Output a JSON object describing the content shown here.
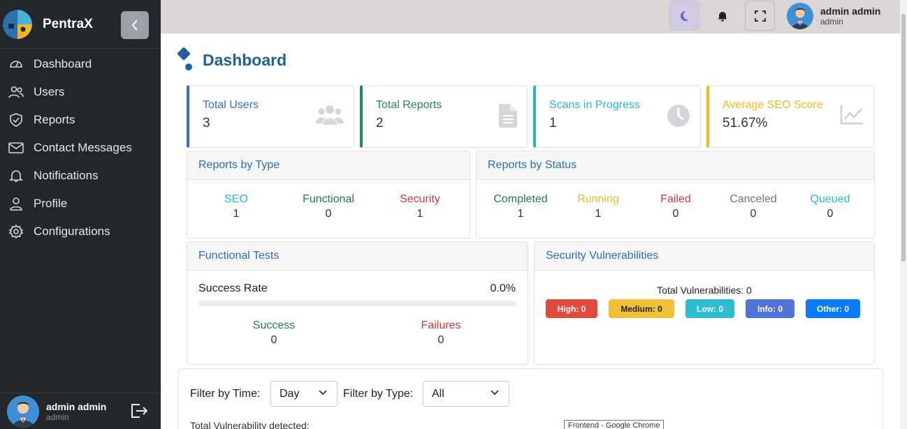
{
  "brand": {
    "name": "PentraX"
  },
  "sidebar": {
    "items": [
      {
        "label": "Dashboard",
        "icon": "dashboard-icon"
      },
      {
        "label": "Users",
        "icon": "users-icon"
      },
      {
        "label": "Reports",
        "icon": "shield-icon"
      },
      {
        "label": "Contact Messages",
        "icon": "envelope-icon"
      },
      {
        "label": "Notifications",
        "icon": "bell-icon"
      },
      {
        "label": "Profile",
        "icon": "user-icon"
      },
      {
        "label": "Configurations",
        "icon": "gear-icon"
      }
    ],
    "user": {
      "name": "admin admin",
      "role": "admin"
    }
  },
  "topbar": {
    "user": {
      "name": "admin admin",
      "role": "admin"
    }
  },
  "page": {
    "title": "Dashboard"
  },
  "stats": [
    {
      "label": "Total Users",
      "value": "3",
      "color": "#2f6fd6"
    },
    {
      "label": "Total Reports",
      "value": "2",
      "color": "#1e8a5a"
    },
    {
      "label": "Scans in Progress",
      "value": "1",
      "color": "#27b5d0"
    },
    {
      "label": "Average SEO Score",
      "value": "51.67%",
      "color": "#f2b81f"
    }
  ],
  "reports_by_type": {
    "title": "Reports by Type",
    "items": [
      {
        "label": "SEO",
        "value": "1",
        "color": "#27b5d0"
      },
      {
        "label": "Functional",
        "value": "0",
        "color": "#1e7e46"
      },
      {
        "label": "Security",
        "value": "1",
        "color": "#d9343b"
      }
    ]
  },
  "reports_by_status": {
    "title": "Reports by Status",
    "items": [
      {
        "label": "Completed",
        "value": "1",
        "color": "#1e7e46"
      },
      {
        "label": "Running",
        "value": "1",
        "color": "#f2b81f"
      },
      {
        "label": "Failed",
        "value": "0",
        "color": "#d9343b"
      },
      {
        "label": "Canceled",
        "value": "0",
        "color": "#6c757d"
      },
      {
        "label": "Queued",
        "value": "0",
        "color": "#27b5d0"
      }
    ]
  },
  "functional_tests": {
    "title": "Functional Tests",
    "success_rate_label": "Success Rate",
    "success_rate": "0.0%",
    "success_rate_fraction": 0.0,
    "success_label": "Success",
    "success_value": "0",
    "failures_label": "Failures",
    "failures_value": "0"
  },
  "security": {
    "title": "Security Vulnerabilities",
    "total_text": "Total Vulnerabilities: 0",
    "badges": [
      {
        "label": "High: 0",
        "color": "#e04a3c",
        "text_color": "#ffffff"
      },
      {
        "label": "Medium: 0",
        "color": "#f2c037",
        "text_color": "#222222"
      },
      {
        "label": "Low: 0",
        "color": "#2fbcd0",
        "text_color": "#ffffff"
      },
      {
        "label": "Info: 0",
        "color": "#4f73d9",
        "text_color": "#ffffff"
      },
      {
        "label": "Other: 0",
        "color": "#0b7dfc",
        "text_color": "#ffffff"
      }
    ]
  },
  "filters": {
    "time_label": "Filter by Time:",
    "time_value": "Day",
    "type_label": "Filter by Type:",
    "type_value": "All",
    "total_vuln_label": "Total Vulnerability detected:",
    "tooltip": "Frontend - Google Chrome"
  }
}
